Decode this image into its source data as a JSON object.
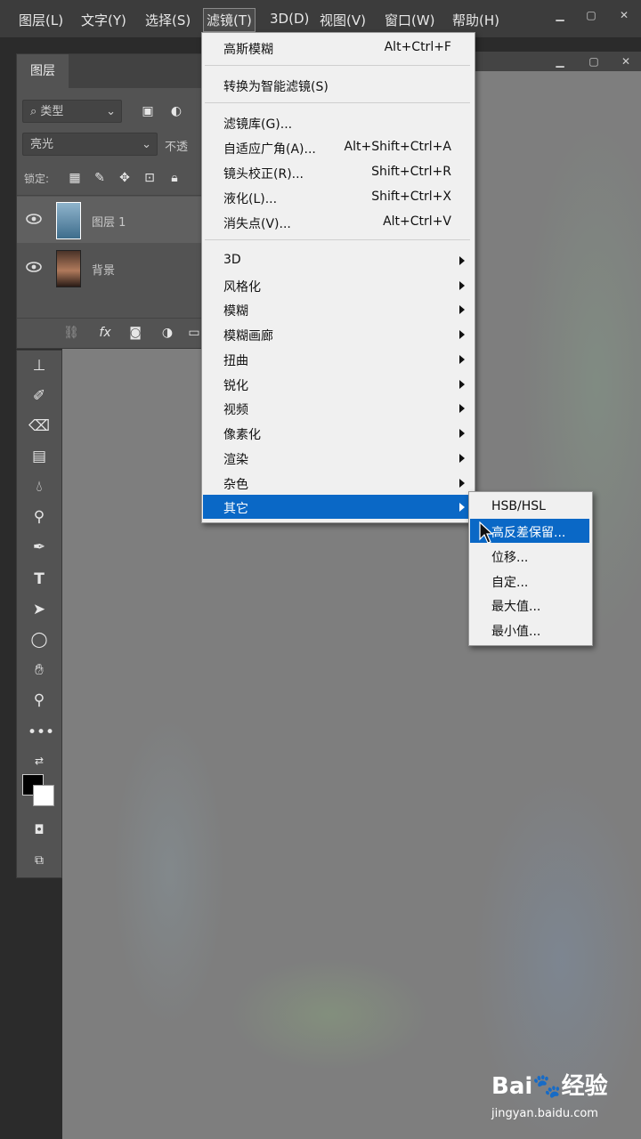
{
  "menubar": {
    "items": [
      "图层(L)",
      "文字(Y)",
      "选择(S)",
      "滤镜(T)",
      "3D(D)",
      "视图(V)",
      "窗口(W)",
      "帮助(H)"
    ],
    "active_index": 3
  },
  "layers_panel": {
    "tab": "图层",
    "filter_value": "类型",
    "blend_mode": "亮光",
    "opacity_label": "不透",
    "lock_label": "锁定:",
    "layers": [
      {
        "name": "图层 1",
        "selected": true
      },
      {
        "name": "背景",
        "selected": false
      }
    ]
  },
  "filter_menu": {
    "items": [
      {
        "label": "高斯模糊",
        "shortcut": "Alt+Ctrl+F"
      },
      {
        "label": "转换为智能滤镜(S)",
        "shortcut": ""
      },
      {
        "label": "滤镜库(G)...",
        "shortcut": ""
      },
      {
        "label": "自适应广角(A)...",
        "shortcut": "Alt+Shift+Ctrl+A"
      },
      {
        "label": "镜头校正(R)...",
        "shortcut": "Shift+Ctrl+R"
      },
      {
        "label": "液化(L)...",
        "shortcut": "Shift+Ctrl+X"
      },
      {
        "label": "消失点(V)...",
        "shortcut": "Alt+Ctrl+V"
      },
      {
        "label": "3D",
        "submenu": true
      },
      {
        "label": "风格化",
        "submenu": true
      },
      {
        "label": "模糊",
        "submenu": true
      },
      {
        "label": "模糊画廊",
        "submenu": true
      },
      {
        "label": "扭曲",
        "submenu": true
      },
      {
        "label": "锐化",
        "submenu": true
      },
      {
        "label": "视频",
        "submenu": true
      },
      {
        "label": "像素化",
        "submenu": true
      },
      {
        "label": "渲染",
        "submenu": true
      },
      {
        "label": "杂色",
        "submenu": true
      },
      {
        "label": "其它",
        "submenu": true,
        "highlighted": true
      }
    ]
  },
  "other_submenu": {
    "items": [
      {
        "label": "HSB/HSL"
      },
      {
        "label": "高反差保留...",
        "highlighted": true
      },
      {
        "label": "位移..."
      },
      {
        "label": "自定..."
      },
      {
        "label": "最大值..."
      },
      {
        "label": "最小值..."
      }
    ]
  },
  "watermark": {
    "logo": "Bai🐾经验",
    "url": "jingyan.baidu.com"
  },
  "colors": {
    "menu_highlight": "#0a68c6",
    "app_chrome": "#3c3c3c",
    "panel": "#535353"
  }
}
